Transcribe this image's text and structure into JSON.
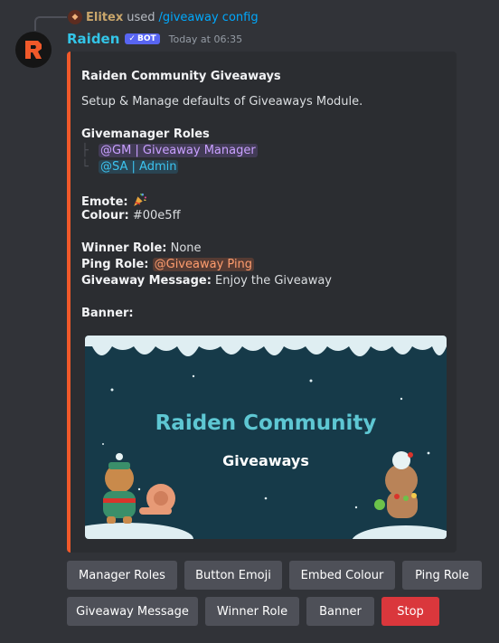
{
  "reply": {
    "user": "Elitex",
    "used": "used",
    "command": "/giveaway config"
  },
  "message": {
    "bot_name": "Raiden",
    "bot_tag": "BOT",
    "timestamp": "Today at 06:35"
  },
  "embed": {
    "accent_color": "#f0592a",
    "title": "Raiden Community Giveaways",
    "description": "Setup & Manage defaults of Giveaways Module.",
    "managers_label": "Givemanager Roles",
    "manager_roles": [
      "@GM | Giveaway Manager",
      "@SA | Admin"
    ],
    "emote_label": "Emote:",
    "emote_icon": "party-popper",
    "colour_label": "Colour:",
    "colour_value": "#00e5ff",
    "winner_role_label": "Winner Role:",
    "winner_role_value": "None",
    "ping_role_label": "Ping Role:",
    "ping_role_value": "@Giveaway Ping",
    "message_label": "Giveaway Message:",
    "message_value": "Enjoy the Giveaway",
    "banner_label": "Banner:",
    "banner": {
      "title": "Raiden Community",
      "subtitle": "Giveaways"
    }
  },
  "buttons_row1": [
    "Manager Roles",
    "Button Emoji",
    "Embed Colour",
    "Ping Role"
  ],
  "buttons_row2": [
    "Giveaway Message",
    "Winner Role",
    "Banner",
    "Stop"
  ]
}
